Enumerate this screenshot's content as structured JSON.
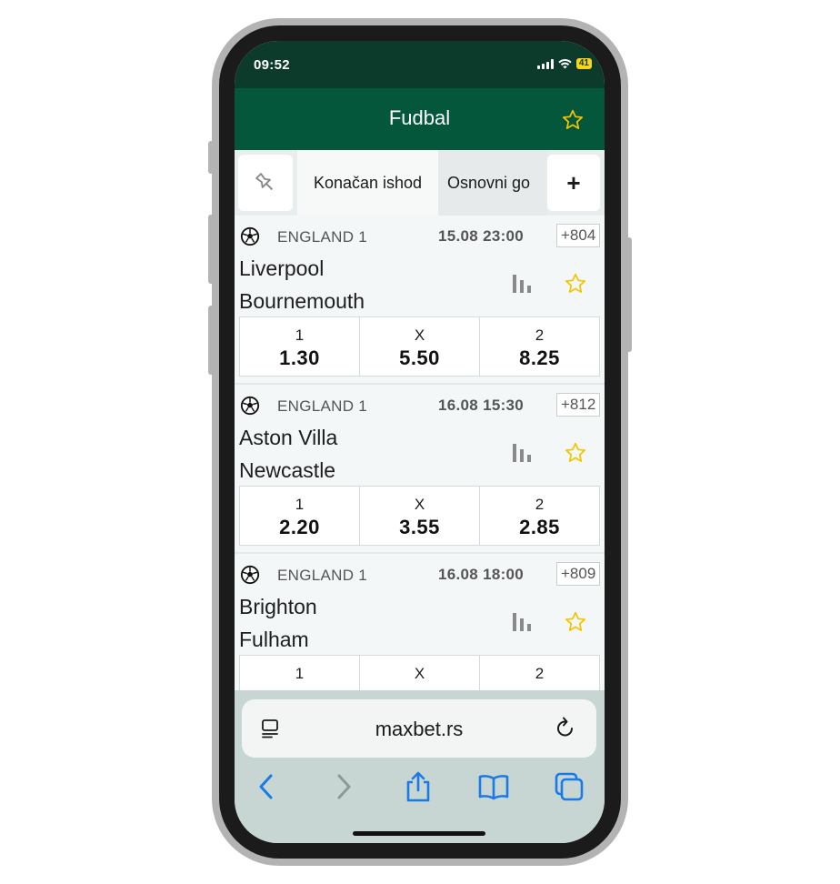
{
  "status": {
    "time": "09:52",
    "battery": "41"
  },
  "header": {
    "title": "Fudbal"
  },
  "tabs": {
    "items": [
      "Konačan ishod",
      "Osnovni go"
    ],
    "add_label": "+"
  },
  "matches": [
    {
      "league": "ENGLAND 1",
      "datetime": "15.08 23:00",
      "more": "+804",
      "home": "Liverpool",
      "away": "Bournemouth",
      "odds": [
        {
          "label": "1",
          "value": "1.30"
        },
        {
          "label": "X",
          "value": "5.50"
        },
        {
          "label": "2",
          "value": "8.25"
        }
      ]
    },
    {
      "league": "ENGLAND 1",
      "datetime": "16.08 15:30",
      "more": "+812",
      "home": "Aston Villa",
      "away": "Newcastle",
      "odds": [
        {
          "label": "1",
          "value": "2.20"
        },
        {
          "label": "X",
          "value": "3.55"
        },
        {
          "label": "2",
          "value": "2.85"
        }
      ]
    },
    {
      "league": "ENGLAND 1",
      "datetime": "16.08 18:00",
      "more": "+809",
      "home": "Brighton",
      "away": "Fulham",
      "odds": [
        {
          "label": "1",
          "value": ""
        },
        {
          "label": "X",
          "value": ""
        },
        {
          "label": "2",
          "value": ""
        }
      ]
    }
  ],
  "browser": {
    "url": "maxbet.rs"
  },
  "colors": {
    "header": "#05573c",
    "status": "#0c3b2b",
    "star": "#f2c500",
    "link": "#1a7ae6"
  }
}
